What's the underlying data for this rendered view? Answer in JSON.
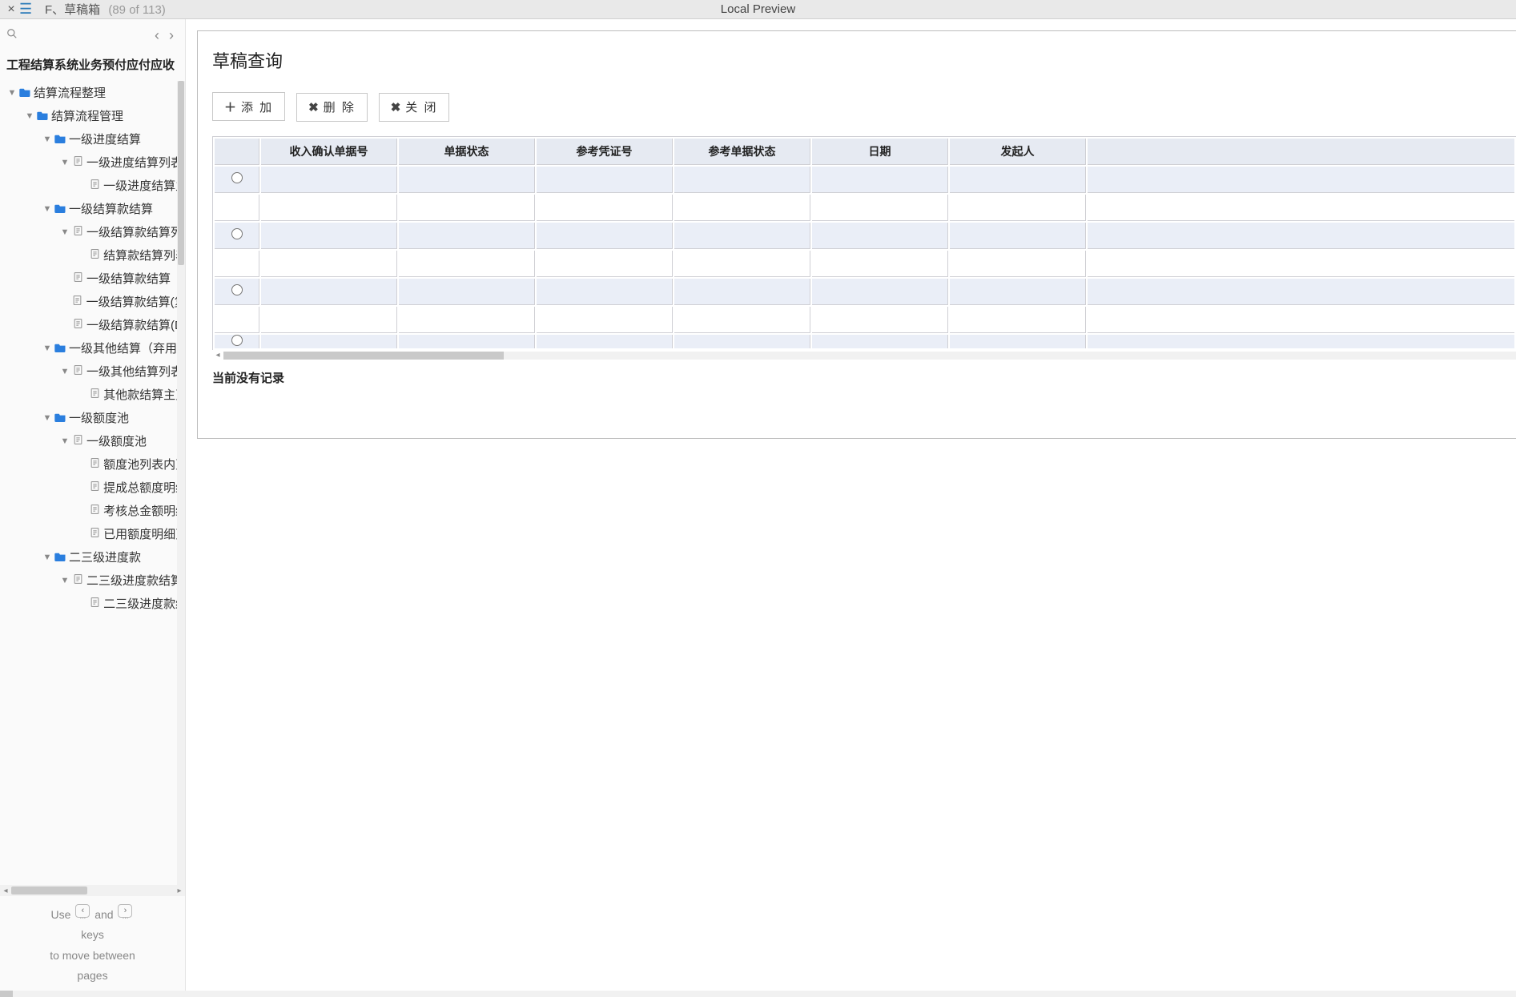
{
  "topbar": {
    "crumb_label": "F、草稿箱",
    "crumb_count": "(89 of 113)",
    "center_label": "Local Preview"
  },
  "sidebar": {
    "title": "工程结算系统业务预付应付应收",
    "hint_use": "Use",
    "hint_and": "and",
    "hint_keys": "keys",
    "hint_move": "to move between",
    "hint_pages": "pages"
  },
  "tree": [
    {
      "d": 0,
      "caret": "▼",
      "ic": "folder",
      "lbl": "结算流程整理"
    },
    {
      "d": 1,
      "caret": "▼",
      "ic": "folder",
      "lbl": "结算流程管理"
    },
    {
      "d": 2,
      "caret": "▼",
      "ic": "folder",
      "lbl": "一级进度结算"
    },
    {
      "d": 3,
      "caret": "▼",
      "ic": "doc",
      "lbl": "一级进度结算列表"
    },
    {
      "d": 4,
      "caret": "",
      "ic": "doc",
      "lbl": "一级进度结算主"
    },
    {
      "d": 2,
      "caret": "▼",
      "ic": "folder",
      "lbl": "一级结算款结算"
    },
    {
      "d": 3,
      "caret": "▼",
      "ic": "doc",
      "lbl": "一级结算款结算列"
    },
    {
      "d": 4,
      "caret": "",
      "ic": "doc",
      "lbl": "结算款结算列表"
    },
    {
      "d": 3,
      "caret": "",
      "ic": "doc",
      "lbl": "一级结算款结算（"
    },
    {
      "d": 3,
      "caret": "",
      "ic": "doc",
      "lbl": "一级结算款结算(复"
    },
    {
      "d": 3,
      "caret": "",
      "ic": "doc",
      "lbl": "一级结算款结算(D"
    },
    {
      "d": 2,
      "caret": "▼",
      "ic": "folder",
      "lbl": "一级其他结算（弃用"
    },
    {
      "d": 3,
      "caret": "▼",
      "ic": "doc",
      "lbl": "一级其他结算列表"
    },
    {
      "d": 4,
      "caret": "",
      "ic": "doc",
      "lbl": "其他款结算主页"
    },
    {
      "d": 2,
      "caret": "▼",
      "ic": "folder",
      "lbl": "一级额度池"
    },
    {
      "d": 3,
      "caret": "▼",
      "ic": "doc",
      "lbl": "一级额度池"
    },
    {
      "d": 4,
      "caret": "",
      "ic": "doc",
      "lbl": "额度池列表内页"
    },
    {
      "d": 4,
      "caret": "",
      "ic": "doc",
      "lbl": "提成总额度明细"
    },
    {
      "d": 4,
      "caret": "",
      "ic": "doc",
      "lbl": "考核总金额明细"
    },
    {
      "d": 4,
      "caret": "",
      "ic": "doc",
      "lbl": "已用额度明细页"
    },
    {
      "d": 2,
      "caret": "▼",
      "ic": "folder",
      "lbl": "二三级进度款"
    },
    {
      "d": 3,
      "caret": "▼",
      "ic": "doc",
      "lbl": "二三级进度款结算"
    },
    {
      "d": 4,
      "caret": "",
      "ic": "doc",
      "lbl": "二三级进度款结"
    }
  ],
  "panel": {
    "title": "草稿查询",
    "btn_add": "添 加",
    "btn_delete": "删 除",
    "btn_close": "关 闭",
    "footer": "当前没有记录"
  },
  "columns": [
    "收入确认单据号",
    "单据状态",
    "参考凭证号",
    "参考单据状态",
    "日期",
    "发起人"
  ]
}
